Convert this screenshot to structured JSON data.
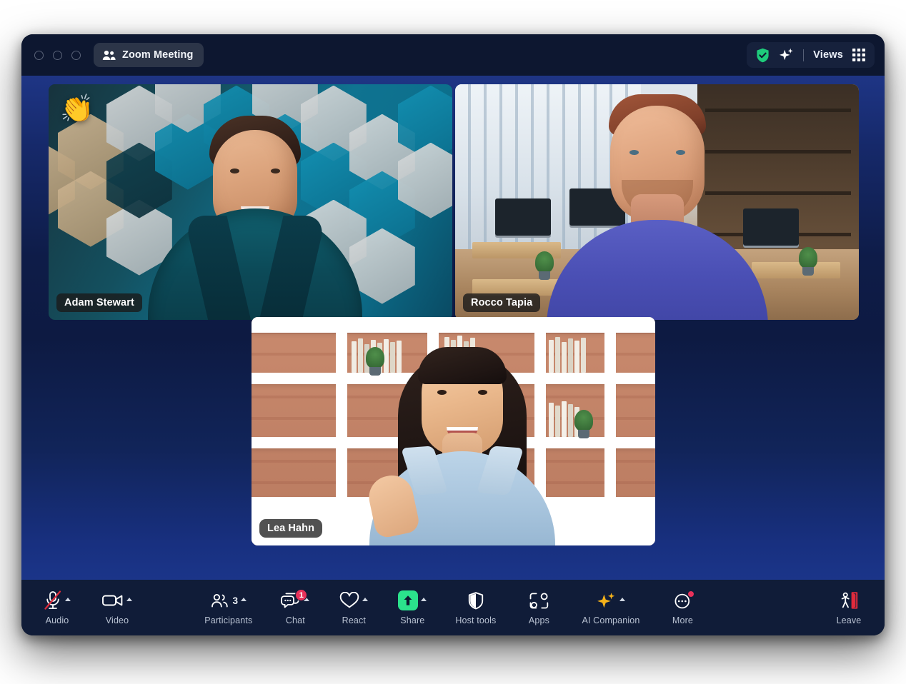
{
  "window": {
    "title": "Zoom Meeting",
    "traffic_lights": [
      "close",
      "minimize",
      "maximize"
    ],
    "titlebar_right": {
      "security_icon": "shield-check-icon",
      "ai_icon": "sparkle-icon",
      "views_label": "Views",
      "views_grid_icon": "grid-icon"
    }
  },
  "colors": {
    "titlebar_bg": "#0d1730",
    "stage_top": "#1e3585",
    "stage_mid": "#0d1a42",
    "stage_bottom": "#1b3589",
    "toolbar_bg": "#101c38",
    "chip_bg": "#2c3548",
    "share_green": "#2be28c",
    "badge_red": "#e8315a",
    "shield_green": "#1ecb7b",
    "ai_gold": "#f5b21a",
    "leave_red": "#e02b3c",
    "mute_slash_red": "#e02b3c",
    "label_gray": "#b9c2d2"
  },
  "gallery": {
    "participants": [
      {
        "name": "Adam Stewart",
        "reaction": "👏",
        "background": "teal-hexagon-wall",
        "attire": "teal blazer, light blue shirt"
      },
      {
        "name": "Rocco Tapia",
        "reaction": "",
        "background": "modern-open-office",
        "attire": "blue t-shirt"
      },
      {
        "name": "Lea Hahn",
        "reaction": "",
        "background": "white-bookshelves-brick-wall",
        "attire": "light blue denim shirt"
      }
    ]
  },
  "toolbar": {
    "left": [
      {
        "label": "Audio",
        "icon": "microphone-muted-icon",
        "has_chevron": true,
        "muted": true
      },
      {
        "label": "Video",
        "icon": "video-camera-icon",
        "has_chevron": true,
        "muted": false
      }
    ],
    "center": [
      {
        "label": "Participants",
        "icon": "participants-icon",
        "has_chevron": true,
        "count": "3"
      },
      {
        "label": "Chat",
        "icon": "chat-bubbles-icon",
        "has_chevron": true,
        "badge": "1"
      },
      {
        "label": "React",
        "icon": "heart-icon",
        "has_chevron": true
      },
      {
        "label": "Share",
        "icon": "share-screen-icon",
        "has_chevron": true
      },
      {
        "label": "Host tools",
        "icon": "shield-icon",
        "has_chevron": false
      },
      {
        "label": "Apps",
        "icon": "apps-icon",
        "has_chevron": false
      },
      {
        "label": "AI Companion",
        "icon": "ai-sparkle-icon",
        "has_chevron": true
      },
      {
        "label": "More",
        "icon": "more-dots-icon",
        "has_chevron": false,
        "badge_dot": true
      }
    ],
    "right": [
      {
        "label": "Leave",
        "icon": "leave-door-icon"
      }
    ]
  }
}
